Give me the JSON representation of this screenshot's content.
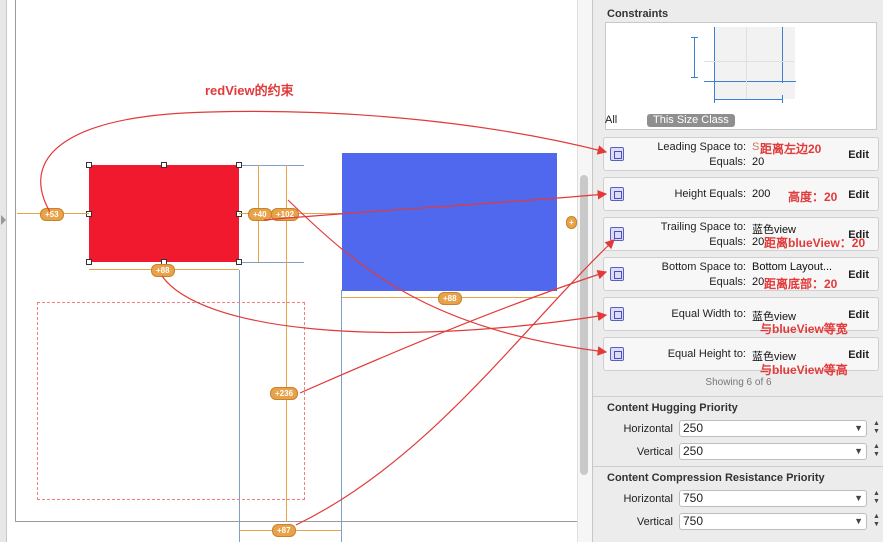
{
  "canvas": {
    "annotation_title": "redView的约束",
    "badges": {
      "leading": "+53",
      "top_gap": "+40",
      "gap_102": "+102",
      "red_width": "+88",
      "blue_width": "+88",
      "vertical": "+236",
      "bottom": "+87",
      "right_edge": "+"
    }
  },
  "inspector": {
    "constraints_title": "Constraints",
    "tabs": {
      "all": "All",
      "size_class": "This Size Class"
    },
    "rows": [
      {
        "label1": "Leading Space to:",
        "value1": "S",
        "label2": "Equals:",
        "value2": "20",
        "note": "距离左边20",
        "edit": "Edit"
      },
      {
        "label1": "Height Equals:",
        "value1": "200",
        "note": "高度：20",
        "edit": "Edit"
      },
      {
        "label1": "Trailing Space to:",
        "value1": "蓝色view",
        "label2": "Equals:",
        "value2": "20",
        "note": "距离blueView：20",
        "edit": "Edit"
      },
      {
        "label1": "Bottom Space to:",
        "value1": "Bottom Layout...",
        "label2": "Equals:",
        "value2": "20",
        "note": "距离底部：20",
        "edit": "Edit"
      },
      {
        "label1": "Equal Width to:",
        "value1": "蓝色view",
        "note": "与blueView等宽",
        "edit": "Edit"
      },
      {
        "label1": "Equal Height to:",
        "value1": "蓝色view",
        "note": "与blueView等高",
        "edit": "Edit"
      }
    ],
    "showing": "Showing 6 of 6",
    "hugging": {
      "title": "Content Hugging Priority",
      "horizontal_label": "Horizontal",
      "horizontal": "250",
      "vertical_label": "Vertical",
      "vertical": "250"
    },
    "compression": {
      "title": "Content Compression Resistance Priority",
      "horizontal_label": "Horizontal",
      "horizontal": "750",
      "vertical_label": "Vertical",
      "vertical": "750"
    }
  },
  "colors": {
    "red_view": "#f0192e",
    "blue_view": "#5068ee",
    "guide": "#e8a24a",
    "annotation": "#e23a3a"
  }
}
